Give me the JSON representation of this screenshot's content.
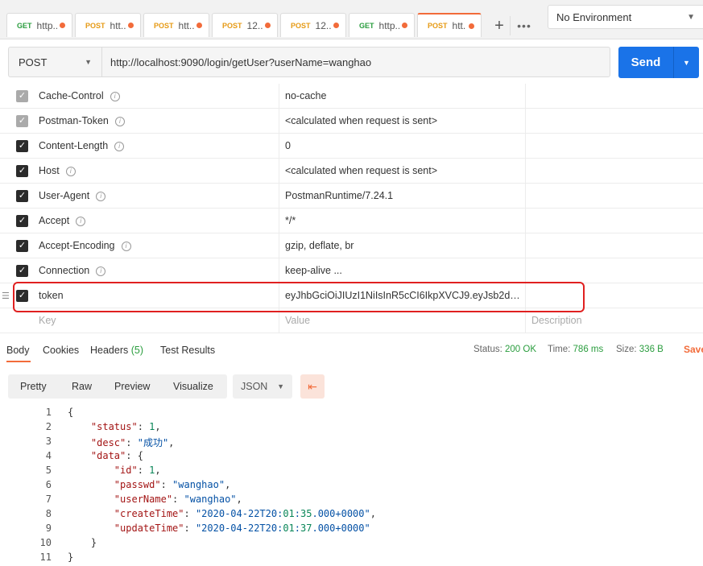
{
  "tabs": [
    {
      "method": "GET",
      "url": "http...",
      "method_class": "get"
    },
    {
      "method": "POST",
      "url": "htt...",
      "method_class": "post"
    },
    {
      "method": "POST",
      "url": "htt...",
      "method_class": "post"
    },
    {
      "method": "POST",
      "url": "12...",
      "method_class": "post"
    },
    {
      "method": "POST",
      "url": "12...",
      "method_class": "post"
    },
    {
      "method": "GET",
      "url": "http...",
      "method_class": "get"
    },
    {
      "method": "POST",
      "url": "htt...",
      "method_class": "post"
    }
  ],
  "tab_add_label": "+",
  "tab_more_label": "•••",
  "environment": "No Environment",
  "request": {
    "method": "POST",
    "url": "http://localhost:9090/login/getUser?userName=wanghao",
    "send_label": "Send"
  },
  "headers": [
    {
      "key": "Cache-Control",
      "value": "no-cache",
      "checked": "dim",
      "info": true
    },
    {
      "key": "Postman-Token",
      "value": "<calculated when request is sent>",
      "checked": "dim",
      "info": true
    },
    {
      "key": "Content-Length",
      "value": "0",
      "checked": "on",
      "info": true
    },
    {
      "key": "Host",
      "value": "<calculated when request is sent>",
      "checked": "on",
      "info": true
    },
    {
      "key": "User-Agent",
      "value": "PostmanRuntime/7.24.1",
      "checked": "on",
      "info": true
    },
    {
      "key": "Accept",
      "value": "*/*",
      "checked": "on",
      "info": true
    },
    {
      "key": "Accept-Encoding",
      "value": "gzip, deflate, br",
      "checked": "on",
      "info": true
    },
    {
      "key": "Connection",
      "value": "keep-alive ...",
      "checked": "on",
      "info": true
    },
    {
      "key": "token",
      "value": "eyJhbGciOiJIUzI1NiIsInR5cCI6IkpXVCJ9.eyJsb2dpbk...",
      "checked": "on",
      "info": false
    }
  ],
  "new_header": {
    "key": "Key",
    "value": "Value",
    "description": "Description"
  },
  "response_tabs": {
    "body": "Body",
    "cookies": "Cookies",
    "headers": "Headers",
    "headers_count": "(5)",
    "test_results": "Test Results"
  },
  "status": {
    "status_label": "Status:",
    "status_value": "200 OK",
    "time_label": "Time:",
    "time_value": "786 ms",
    "size_label": "Size:",
    "size_value": "336 B",
    "save_label": "Save"
  },
  "body_toolbar": {
    "pretty": "Pretty",
    "raw": "Raw",
    "preview": "Preview",
    "visualize": "Visualize",
    "format": "JSON"
  },
  "code_lines": [
    {
      "n": "1",
      "text": "{"
    },
    {
      "n": "2",
      "text": "    \"status\": 1,"
    },
    {
      "n": "3",
      "text": "    \"desc\": \"成功\","
    },
    {
      "n": "4",
      "text": "    \"data\": {"
    },
    {
      "n": "5",
      "text": "        \"id\": 1,"
    },
    {
      "n": "6",
      "text": "        \"passwd\": \"wanghao\","
    },
    {
      "n": "7",
      "text": "        \"userName\": \"wanghao\","
    },
    {
      "n": "8",
      "text": "        \"createTime\": \"2020-04-22T20:01:35.000+0000\","
    },
    {
      "n": "9",
      "text": "        \"updateTime\": \"2020-04-22T20:01:37.000+0000\""
    },
    {
      "n": "10",
      "text": "    }"
    },
    {
      "n": "11",
      "text": "}"
    }
  ],
  "colors": {
    "accent": "#f26b3a",
    "send": "#1a73e8",
    "ok": "#2a9d3e",
    "highlight": "#e02020"
  }
}
